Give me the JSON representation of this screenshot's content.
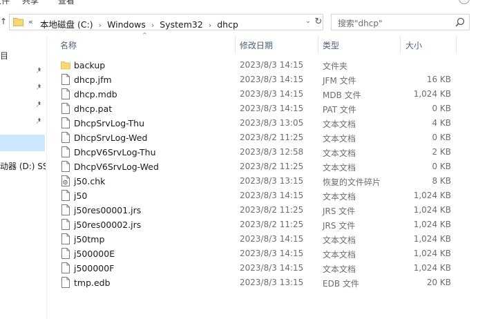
{
  "ribbon": {
    "tabs": [
      "文件",
      "共享",
      "查看"
    ]
  },
  "address": {
    "overflow_glyph": "«",
    "crumbs": [
      "本地磁盘 (C:)",
      "Windows",
      "System32",
      "dhcp"
    ],
    "separator": "›",
    "dropdown_glyph": "⌄",
    "refresh_glyph": "↻"
  },
  "search": {
    "placeholder": "搜索\"dhcp\""
  },
  "navpane": {
    "partial_label": "目",
    "drive_label": "动器 (D:) SSD"
  },
  "columns": {
    "name": "名称",
    "date": "修改日期",
    "type": "类型",
    "size": "大小"
  },
  "files": [
    {
      "name": "backup",
      "date": "2023/8/3 14:15",
      "type": "文件夹",
      "size": "",
      "icon": "folder-icon"
    },
    {
      "name": "dhcp.jfm",
      "date": "2023/8/3 14:15",
      "type": "JFM 文件",
      "size": "16 KB",
      "icon": "file-icon"
    },
    {
      "name": "dhcp.mdb",
      "date": "2023/8/3 14:15",
      "type": "MDB 文件",
      "size": "1,024 KB",
      "icon": "file-icon"
    },
    {
      "name": "dhcp.pat",
      "date": "2023/8/3 14:15",
      "type": "PAT 文件",
      "size": "0 KB",
      "icon": "file-icon"
    },
    {
      "name": "DhcpSrvLog-Thu",
      "date": "2023/8/3 13:05",
      "type": "文本文档",
      "size": "4 KB",
      "icon": "file-icon"
    },
    {
      "name": "DhcpSrvLog-Wed",
      "date": "2023/8/2 11:25",
      "type": "文本文档",
      "size": "0 KB",
      "icon": "file-icon"
    },
    {
      "name": "DhcpV6SrvLog-Thu",
      "date": "2023/8/3 12:58",
      "type": "文本文档",
      "size": "2 KB",
      "icon": "file-icon"
    },
    {
      "name": "DhcpV6SrvLog-Wed",
      "date": "2023/8/2 11:25",
      "type": "文本文档",
      "size": "0 KB",
      "icon": "file-icon"
    },
    {
      "name": "j50.chk",
      "date": "2023/8/3 13:15",
      "type": "恢复的文件碎片",
      "size": "8 KB",
      "icon": "chk-file-icon"
    },
    {
      "name": "j50",
      "date": "2023/8/3 14:15",
      "type": "文本文档",
      "size": "1,024 KB",
      "icon": "file-icon"
    },
    {
      "name": "j50res00001.jrs",
      "date": "2023/8/2 11:25",
      "type": "JRS 文件",
      "size": "1,024 KB",
      "icon": "file-icon"
    },
    {
      "name": "j50res00002.jrs",
      "date": "2023/8/2 11:25",
      "type": "JRS 文件",
      "size": "1,024 KB",
      "icon": "file-icon"
    },
    {
      "name": "j50tmp",
      "date": "2023/8/3 14:15",
      "type": "文本文档",
      "size": "1,024 KB",
      "icon": "file-icon"
    },
    {
      "name": "j500000E",
      "date": "2023/8/3 14:15",
      "type": "文本文档",
      "size": "1,024 KB",
      "icon": "file-icon"
    },
    {
      "name": "j500000F",
      "date": "2023/8/3 14:15",
      "type": "文本文档",
      "size": "1,024 KB",
      "icon": "file-icon"
    },
    {
      "name": "tmp.edb",
      "date": "2023/8/3 13:15",
      "type": "EDB 文件",
      "size": "20 KB",
      "icon": "file-icon"
    }
  ],
  "colors": {
    "selection": "#cce8ff",
    "folder": "#f8d775",
    "header_text": "#4c607a",
    "secondary_text": "#6d6d6d"
  }
}
